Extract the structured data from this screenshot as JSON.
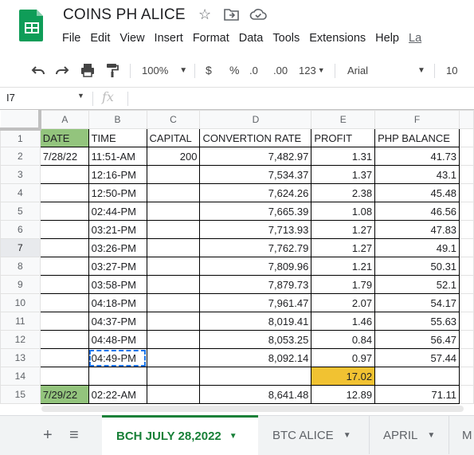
{
  "app": {
    "doc_title": "COINS PH ALICE",
    "menu": [
      "File",
      "Edit",
      "View",
      "Insert",
      "Format",
      "Data",
      "Tools",
      "Extensions",
      "Help",
      "La"
    ],
    "brand_color": "#0f9d58"
  },
  "toolbar": {
    "zoom": "100%",
    "currency": "$",
    "percent": "%",
    "dec_decrease": ".0",
    "dec_increase": ".00",
    "number_format": "123",
    "font": "Arial",
    "font_size": "10"
  },
  "formula_bar": {
    "name_box": "I7",
    "fx": "fx",
    "value": ""
  },
  "sheet": {
    "columns": [
      "A",
      "B",
      "C",
      "D",
      "E",
      "F"
    ],
    "rows": [
      {
        "n": "1",
        "a": "DATE",
        "b": "TIME",
        "c": "CAPITAL",
        "d": "CONVERTION RATE",
        "e": "PROFIT",
        "f": "PHP BALANCE"
      },
      {
        "n": "2",
        "a": "7/28/22",
        "b": "11:51-AM",
        "c": "200",
        "d": "7,482.97",
        "e": "1.31",
        "f": "41.73"
      },
      {
        "n": "3",
        "a": "",
        "b": "12:16-PM",
        "c": "",
        "d": "7,534.37",
        "e": "1.37",
        "f": "43.1"
      },
      {
        "n": "4",
        "a": "",
        "b": "12:50-PM",
        "c": "",
        "d": "7,624.26",
        "e": "2.38",
        "f": "45.48"
      },
      {
        "n": "5",
        "a": "",
        "b": "02:44-PM",
        "c": "",
        "d": "7,665.39",
        "e": "1.08",
        "f": "46.56"
      },
      {
        "n": "6",
        "a": "",
        "b": "03:21-PM",
        "c": "",
        "d": "7,713.93",
        "e": "1.27",
        "f": "47.83"
      },
      {
        "n": "7",
        "a": "",
        "b": "03:26-PM",
        "c": "",
        "d": "7,762.79",
        "e": "1.27",
        "f": "49.1"
      },
      {
        "n": "8",
        "a": "",
        "b": "03:27-PM",
        "c": "",
        "d": "7,809.96",
        "e": "1.21",
        "f": "50.31"
      },
      {
        "n": "9",
        "a": "",
        "b": "03:58-PM",
        "c": "",
        "d": "7,879.73",
        "e": "1.79",
        "f": "52.1"
      },
      {
        "n": "10",
        "a": "",
        "b": "04:18-PM",
        "c": "",
        "d": "7,961.47",
        "e": "2.07",
        "f": "54.17"
      },
      {
        "n": "11",
        "a": "",
        "b": "04:37-PM",
        "c": "",
        "d": "8,019.41",
        "e": "1.46",
        "f": "55.63"
      },
      {
        "n": "12",
        "a": "",
        "b": "04:48-PM",
        "c": "",
        "d": "8,053.25",
        "e": "0.84",
        "f": "56.47"
      },
      {
        "n": "13",
        "a": "",
        "b": "04:49-PM",
        "c": "",
        "d": "8,092.14",
        "e": "0.97",
        "f": "57.44"
      },
      {
        "n": "14",
        "a": "",
        "b": "",
        "c": "",
        "d": "",
        "e": "17.02",
        "f": ""
      },
      {
        "n": "15",
        "a": "7/29/22",
        "b": "02:22-AM",
        "c": "",
        "d": "8,641.48",
        "e": "12.89",
        "f": "71.11"
      }
    ],
    "colors": {
      "header_green": "#93c47d",
      "total_yellow": "#f1c232",
      "selection_blue": "#1a73e8"
    }
  },
  "tabs": {
    "add": "+",
    "list": "≡",
    "items": [
      {
        "label": "BCH JULY 28,2022",
        "active": true
      },
      {
        "label": "BTC ALICE",
        "active": false
      },
      {
        "label": "APRIL",
        "active": false
      },
      {
        "label": "M",
        "active": false
      }
    ]
  }
}
